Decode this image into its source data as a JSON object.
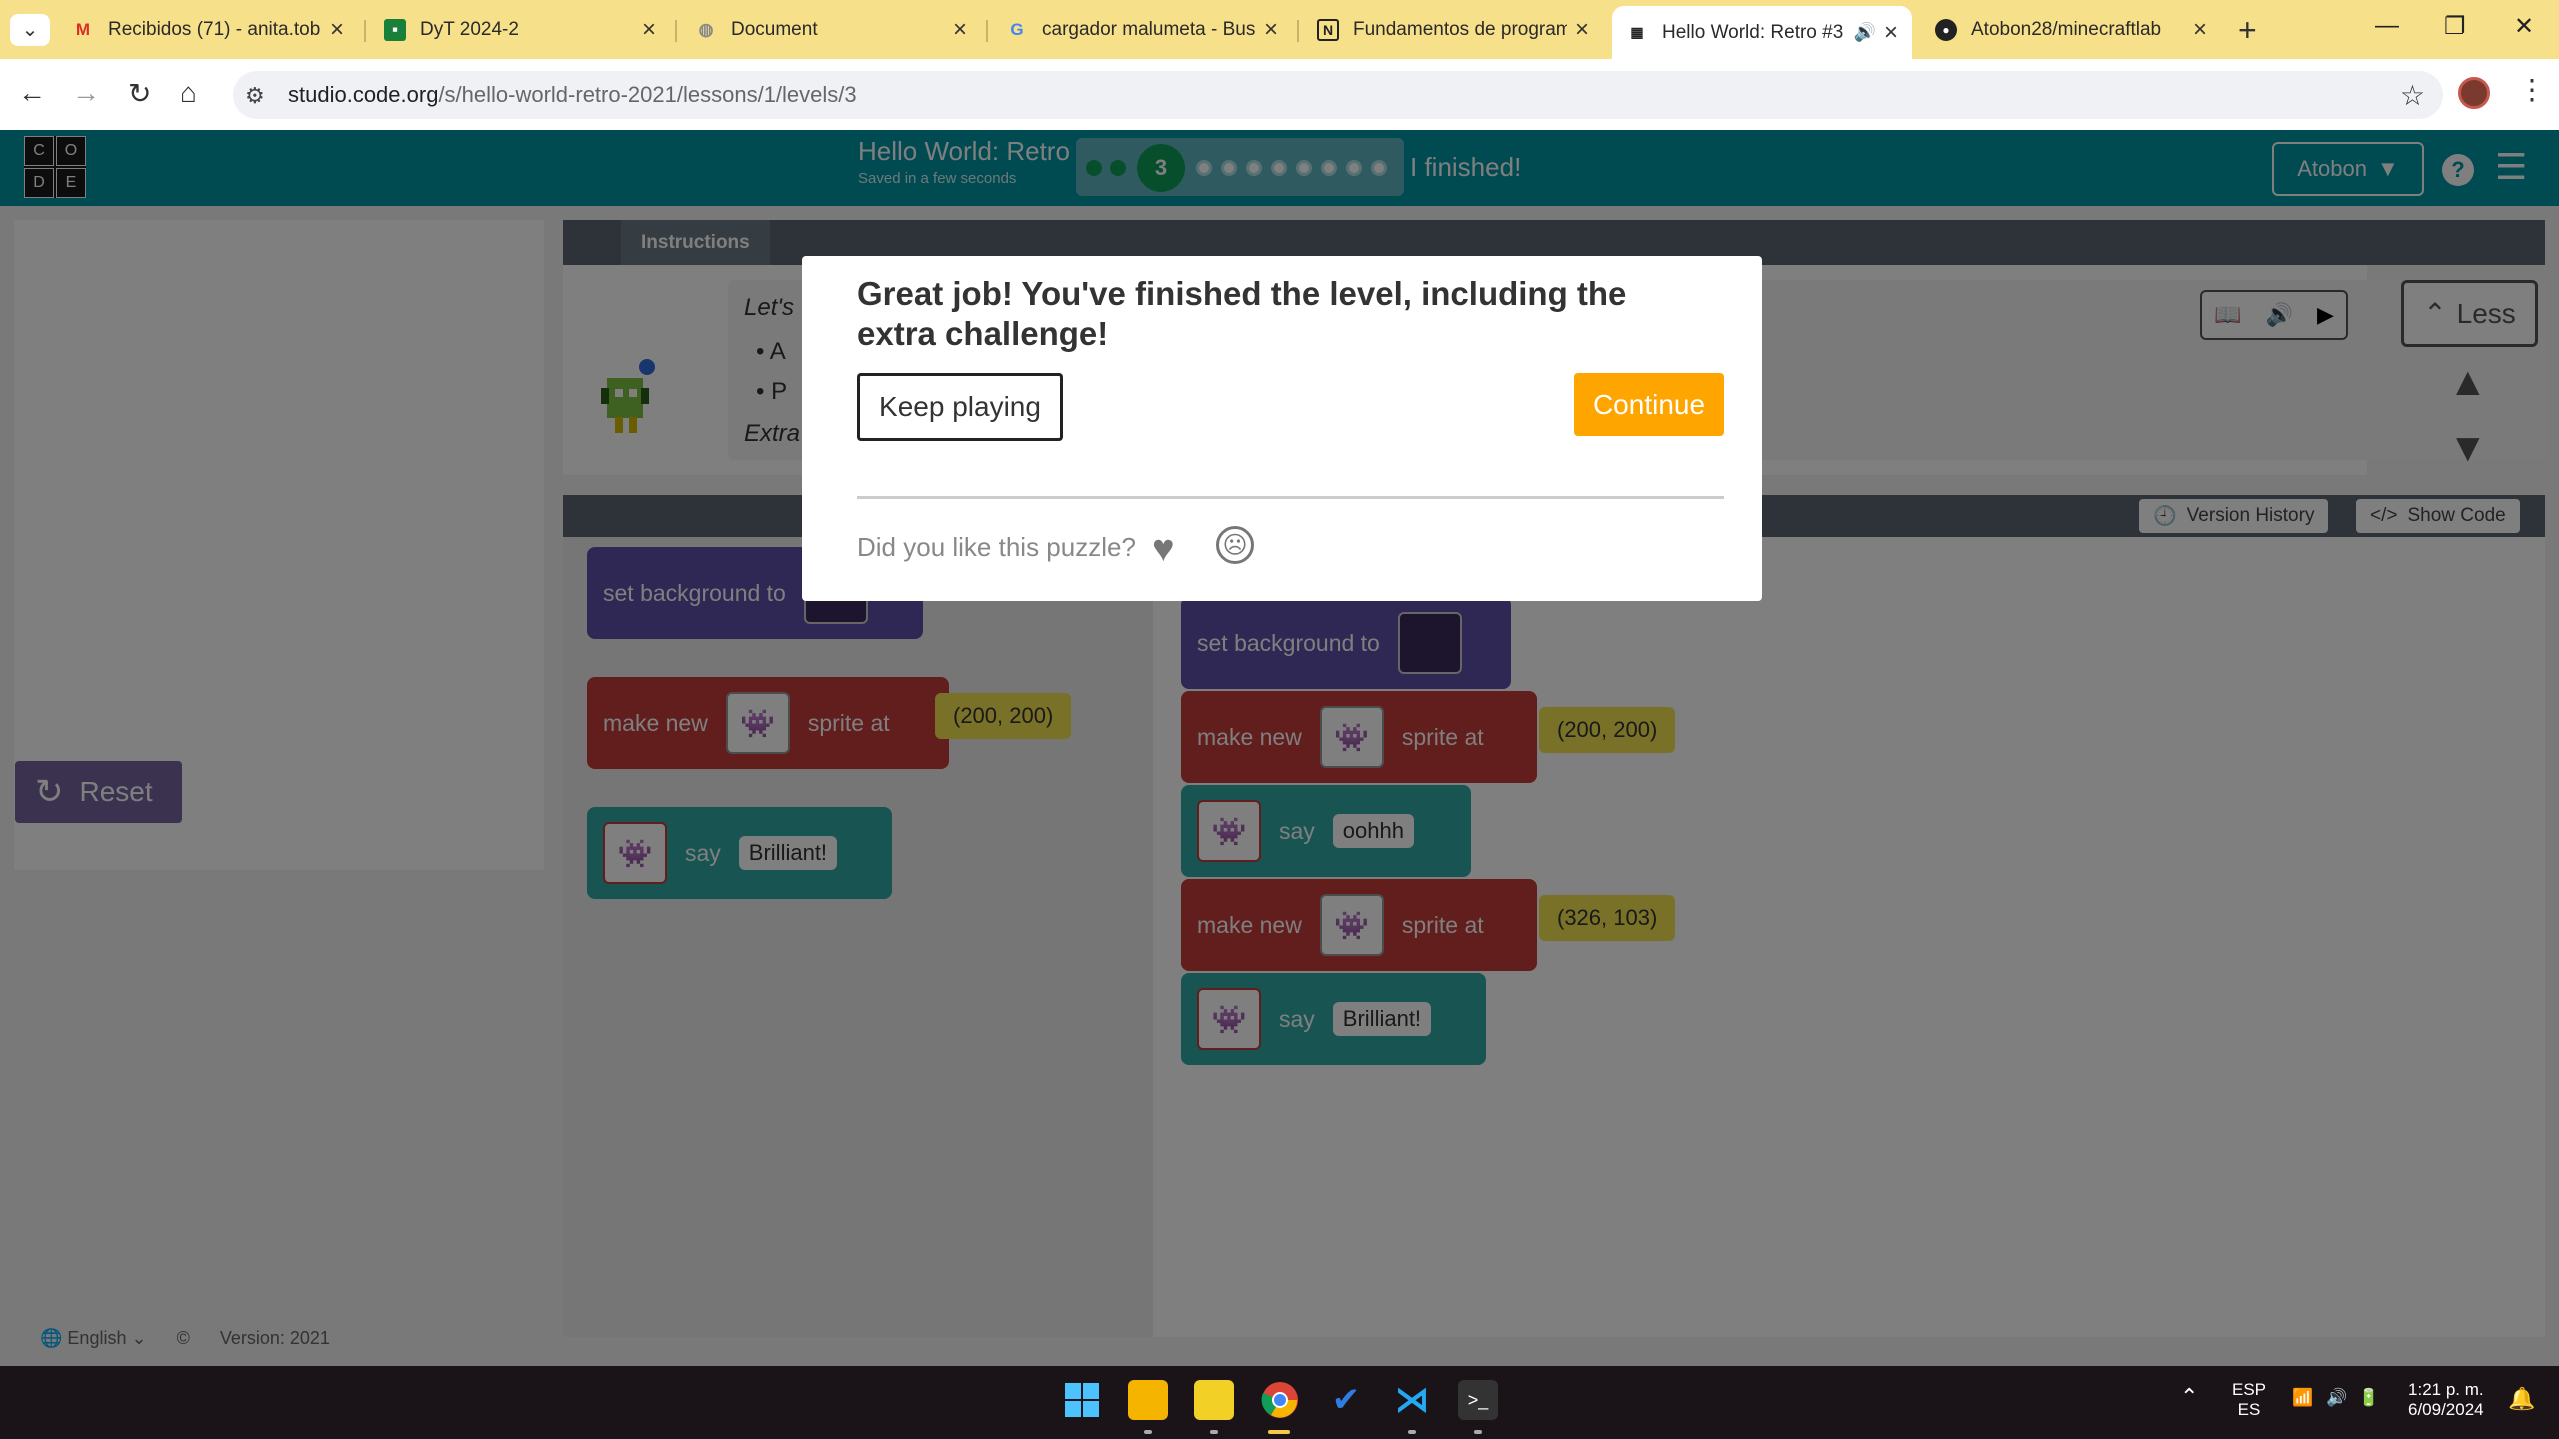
{
  "browser": {
    "tabs": [
      {
        "title": "Recibidos (71) - anita.tob",
        "icon": "gmail-icon"
      },
      {
        "title": "DyT 2024-2",
        "icon": "classroom-icon"
      },
      {
        "title": "Document",
        "icon": "globe-icon"
      },
      {
        "title": "cargador malumeta - Bus",
        "icon": "google-icon"
      },
      {
        "title": "Fundamentos de program",
        "icon": "notion-icon"
      },
      {
        "title": "Hello World: Retro #3",
        "icon": "code-org-icon",
        "active": true
      },
      {
        "title": "Atobon28/minecraftlab",
        "icon": "github-icon"
      }
    ],
    "url_host": "studio.code.org",
    "url_path": "/s/hello-world-retro-2021/lessons/1/levels/3"
  },
  "header": {
    "logo_letters": [
      "C",
      "O",
      "D",
      "E"
    ],
    "level_title": "Hello World: Retro",
    "saved_status": "Saved in a few seconds",
    "current_level": "3",
    "finished_label": "I finished!",
    "user_name": "Atobon",
    "help_label": "?"
  },
  "instructions": {
    "tab_label": "Instructions",
    "line1": "Let's",
    "bullet1": "A",
    "bullet2": "P",
    "line_extra": "Extra",
    "less_label": "Less"
  },
  "left_panel": {
    "reset_label": "Reset",
    "language": "English",
    "version": "Version: 2021"
  },
  "workspace": {
    "version_history_label": "Version History",
    "show_code_label": "Show Code",
    "toolbox_blocks": [
      {
        "text": "set background to"
      },
      {
        "text": "make new",
        "text2": "sprite at",
        "coord": "(200, 200)"
      },
      {
        "text": "say",
        "value": "Brilliant!"
      }
    ],
    "workspace_blocks": [
      {
        "text": "set background to"
      },
      {
        "text": "make new",
        "text2": "sprite at",
        "coord": "(200, 200)"
      },
      {
        "text": "say",
        "value": "oohhh"
      },
      {
        "text": "make new",
        "text2": "sprite at",
        "coord": "(326, 103)"
      },
      {
        "text": "say",
        "value": "Brilliant!"
      }
    ]
  },
  "dialog": {
    "title": "Great job! You've finished the level, including the extra challenge!",
    "keep_playing_label": "Keep playing",
    "continue_label": "Continue",
    "feedback_question": "Did you like this puzzle?"
  },
  "taskbar": {
    "lang_line1": "ESP",
    "lang_line2": "ES",
    "time": "1:21 p. m.",
    "date": "6/09/2024"
  },
  "colors": {
    "tab_strip": "#f7e08a",
    "header_teal": "#0094a5",
    "continue_orange": "#ffa500",
    "block_purple": "#5f4fa8",
    "block_red": "#c53a3a",
    "block_teal": "#2fa9a5",
    "coord_yellow": "#f2e24e"
  }
}
